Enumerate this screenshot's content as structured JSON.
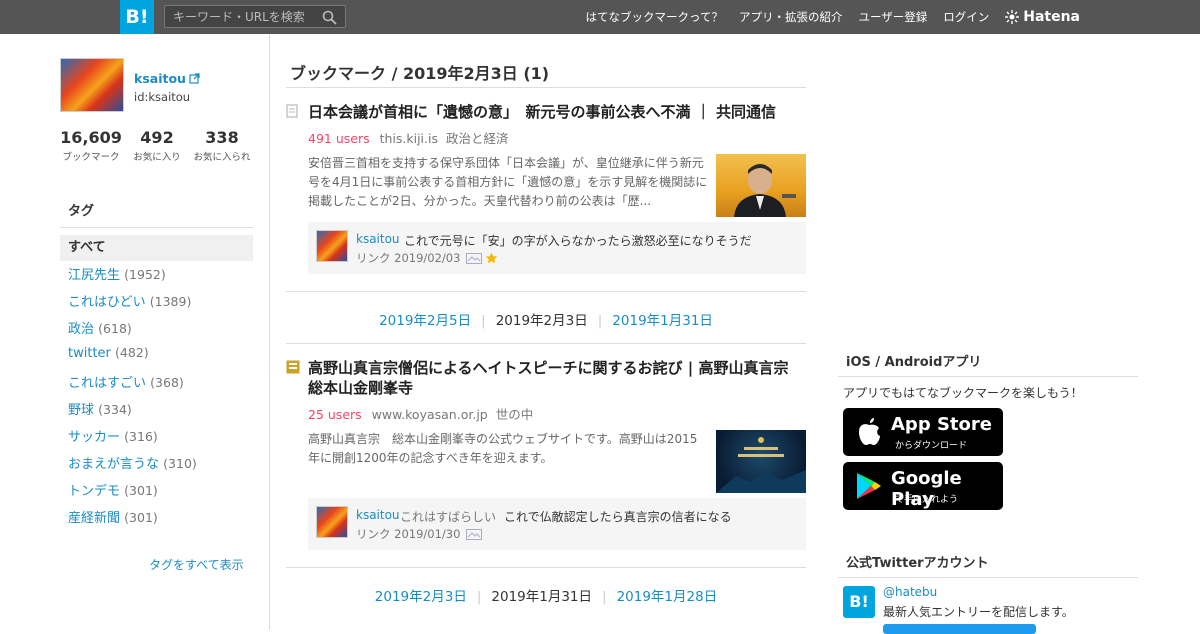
{
  "topbar": {
    "logo": "B!",
    "search_placeholder": "キーワード・URLを検索",
    "nav": [
      "はてなブックマークって？",
      "アプリ・拡張の紹介",
      "ユーザー登録",
      "ログイン"
    ],
    "hatena": "Hatena"
  },
  "profile": {
    "name": "ksaitou",
    "id": "id:ksaitou",
    "stats": [
      {
        "num": "16,609",
        "label": "ブックマーク"
      },
      {
        "num": "492",
        "label": "お気に入り"
      },
      {
        "num": "338",
        "label": "お気に入られ"
      }
    ]
  },
  "tags": {
    "heading": "タグ",
    "all": "すべて",
    "items": [
      {
        "name": "江尻先生",
        "count": "(1952)"
      },
      {
        "name": "これはひどい",
        "count": "(1389)"
      },
      {
        "name": "政治",
        "count": "(618)"
      },
      {
        "name": "twitter",
        "count": "(482)"
      },
      {
        "name": "これはすごい",
        "count": "(368)"
      },
      {
        "name": "野球",
        "count": "(334)"
      },
      {
        "name": "サッカー",
        "count": "(316)"
      },
      {
        "name": "おまえが言うな",
        "count": "(310)"
      },
      {
        "name": "トンデモ",
        "count": "(301)"
      },
      {
        "name": "産経新聞",
        "count": "(301)"
      }
    ],
    "show_all": "タグをすべて表示"
  },
  "main": {
    "title": "ブックマーク / 2019年2月3日 (1)",
    "entries": [
      {
        "title": "日本会議が首相に「遺憾の意」　新元号の事前公表へ不満 ｜ 共同通信",
        "users": "491 users",
        "domain": "this.kiji.is",
        "category": "政治と経済",
        "desc_lines": [
          "安倍晋三首相を支持する保守系団体「日本会議」が、皇位継承に伴う新元",
          "号を4月1日に事前公表する首相方針に「遺憾の意」を示す見解を機関誌に",
          "掲載したことが2日、分かった。天皇代替わり前の公表は「歴..."
        ],
        "comment": {
          "user": "ksaitou",
          "tag": "",
          "text": "これで元号に「安」の字が入らなかったら激怒必至になりそうだ",
          "meta": "リンク 2019/02/03"
        }
      },
      {
        "title": "高野山真言宗僧侶によるヘイトスピーチに関するお詫び | 高野山真言宗 総本山金剛峯寺",
        "users": "25 users",
        "domain": "www.koyasan.or.jp",
        "category": "世の中",
        "desc_lines": [
          "高野山真言宗　総本山金剛峯寺の公式ウェブサイトです。高野山は2015",
          "年に開創1200年の記念すべき年を迎えます。"
        ],
        "comment": {
          "user": "ksaitou",
          "tag": "これはすばらしい",
          "text": "これで仏敵認定したら真言宗の信者になる",
          "meta": "リンク 2019/01/30"
        }
      }
    ],
    "pager1": {
      "prev": "2019年2月5日",
      "cur": "2019年2月3日",
      "next": "2019年1月31日"
    },
    "pager2": {
      "prev": "2019年2月3日",
      "cur": "2019年1月31日",
      "next": "2019年1月28日"
    }
  },
  "right": {
    "app_heading": "iOS / Androidアプリ",
    "app_text": "アプリでもはてなブックマークを楽しもう！",
    "appstore": {
      "big": "App Store",
      "small": "からダウンロード"
    },
    "googleplay": {
      "big": "Google Play",
      "small": "で手に入れよう"
    },
    "twitter_heading": "公式Twitterアカウント",
    "twitter_logo": "B!",
    "twitter_handle": "@hatebu",
    "twitter_desc": "最新人気エントリーを配信します。"
  }
}
